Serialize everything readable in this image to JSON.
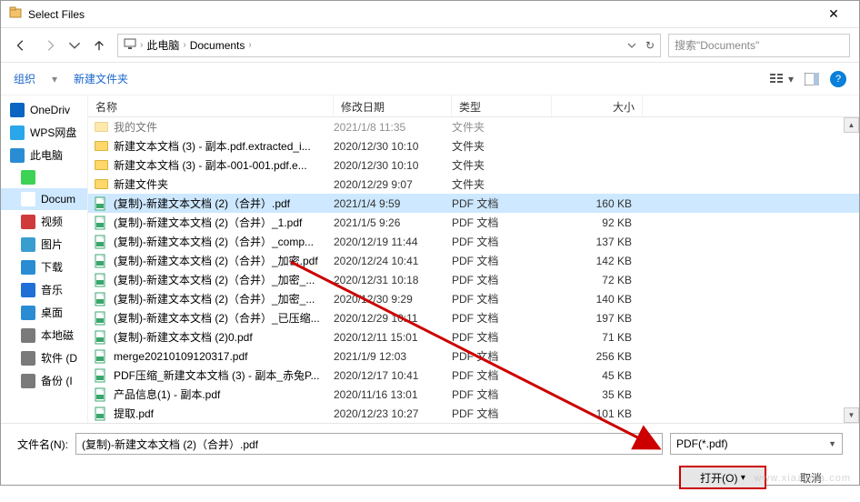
{
  "window": {
    "title": "Select Files"
  },
  "nav": {
    "breadcrumb": [
      "此电脑",
      "Documents"
    ],
    "search_placeholder": "搜索\"Documents\""
  },
  "toolbar": {
    "organize": "组织",
    "new_folder": "新建文件夹"
  },
  "sidebar": {
    "items": [
      {
        "label": "OneDriv",
        "color": "#0a64c2",
        "indent": false
      },
      {
        "label": "WPS网盘",
        "color": "#2aa7ea",
        "indent": false
      },
      {
        "label": "此电脑",
        "color": "#2a8dd4",
        "indent": false
      },
      {
        "label": "",
        "color": "#3bd255",
        "indent": true
      },
      {
        "label": "Docum",
        "color": "#ffffff",
        "indent": true,
        "selected": true
      },
      {
        "label": "视频",
        "color": "#d03a3a",
        "indent": true
      },
      {
        "label": "图片",
        "color": "#3a9dd0",
        "indent": true
      },
      {
        "label": "下载",
        "color": "#2a8dd4",
        "indent": true
      },
      {
        "label": "音乐",
        "color": "#1f6fd6",
        "indent": true
      },
      {
        "label": "桌面",
        "color": "#2a8dd4",
        "indent": true
      },
      {
        "label": "本地磁",
        "color": "#7a7a7a",
        "indent": true
      },
      {
        "label": "软件 (D",
        "color": "#7a7a7a",
        "indent": true
      },
      {
        "label": "备份 (I",
        "color": "#7a7a7a",
        "indent": true
      }
    ]
  },
  "columns": {
    "name": "名称",
    "date": "修改日期",
    "type": "类型",
    "size": "大小"
  },
  "files": [
    {
      "name": "我的文件",
      "date": "2021/1/8 11:35",
      "type": "文件夹",
      "size": "",
      "kind": "folder",
      "faded": true
    },
    {
      "name": "新建文本文档 (3) - 副本.pdf.extracted_i...",
      "date": "2020/12/30 10:10",
      "type": "文件夹",
      "size": "",
      "kind": "folder"
    },
    {
      "name": "新建文本文档 (3) - 副本-001-001.pdf.e...",
      "date": "2020/12/30 10:10",
      "type": "文件夹",
      "size": "",
      "kind": "folder"
    },
    {
      "name": "新建文件夹",
      "date": "2020/12/29 9:07",
      "type": "文件夹",
      "size": "",
      "kind": "folder"
    },
    {
      "name": "(复制)-新建文本文档 (2)（合并）.pdf",
      "date": "2021/1/4 9:59",
      "type": "PDF 文档",
      "size": "160 KB",
      "kind": "pdf",
      "selected": true
    },
    {
      "name": "(复制)-新建文本文档 (2)（合并）_1.pdf",
      "date": "2021/1/5 9:26",
      "type": "PDF 文档",
      "size": "92 KB",
      "kind": "pdf"
    },
    {
      "name": "(复制)-新建文本文档 (2)（合并）_comp...",
      "date": "2020/12/19 11:44",
      "type": "PDF 文档",
      "size": "137 KB",
      "kind": "pdf"
    },
    {
      "name": "(复制)-新建文本文档 (2)（合并）_加密.pdf",
      "date": "2020/12/24 10:41",
      "type": "PDF 文档",
      "size": "142 KB",
      "kind": "pdf"
    },
    {
      "name": "(复制)-新建文本文档 (2)（合并）_加密_...",
      "date": "2020/12/31 10:18",
      "type": "PDF 文档",
      "size": "72 KB",
      "kind": "pdf"
    },
    {
      "name": "(复制)-新建文本文档 (2)（合并）_加密_...",
      "date": "2020/12/30 9:29",
      "type": "PDF 文档",
      "size": "140 KB",
      "kind": "pdf"
    },
    {
      "name": "(复制)-新建文本文档 (2)（合并）_已压缩...",
      "date": "2020/12/29 10:11",
      "type": "PDF 文档",
      "size": "197 KB",
      "kind": "pdf"
    },
    {
      "name": "(复制)-新建文本文档 (2)0.pdf",
      "date": "2020/12/11 15:01",
      "type": "PDF 文档",
      "size": "71 KB",
      "kind": "pdf"
    },
    {
      "name": "merge20210109120317.pdf",
      "date": "2021/1/9 12:03",
      "type": "PDF 文档",
      "size": "256 KB",
      "kind": "pdf"
    },
    {
      "name": "PDF压缩_新建文本文档 (3) - 副本_赤兔P...",
      "date": "2020/12/17 10:41",
      "type": "PDF 文档",
      "size": "45 KB",
      "kind": "pdf"
    },
    {
      "name": "产品信息(1) - 副本.pdf",
      "date": "2020/11/16 13:01",
      "type": "PDF 文档",
      "size": "35 KB",
      "kind": "pdf"
    },
    {
      "name": "提取.pdf",
      "date": "2020/12/23 10:27",
      "type": "PDF 文档",
      "size": "101 KB",
      "kind": "pdf"
    }
  ],
  "footer": {
    "filename_label": "文件名(N):",
    "filename_value": "(复制)-新建文本文档 (2)（合并）.pdf",
    "filter": "PDF(*.pdf)",
    "open": "打开(O)",
    "cancel": "取消"
  },
  "watermark": "www.xiazaiba.com"
}
